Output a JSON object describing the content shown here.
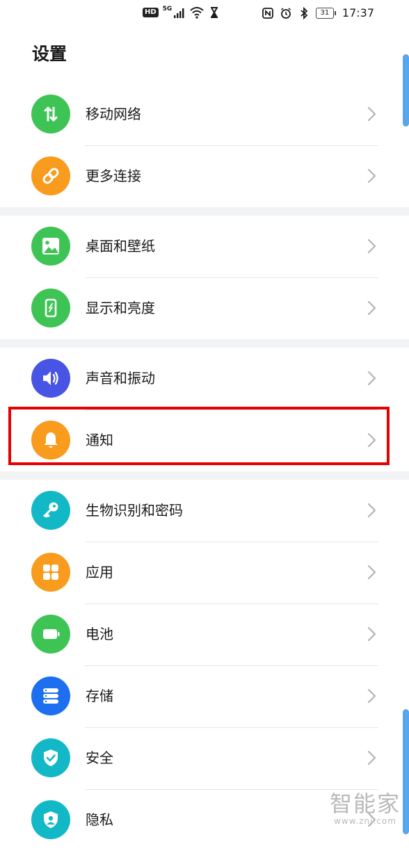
{
  "status_bar": {
    "hd": "HD",
    "network": "5G",
    "battery": "31",
    "time": "17:37",
    "icons": [
      "signal-icon",
      "wifi-icon",
      "hourglass-icon",
      "nfc-icon",
      "alarm-icon",
      "bluetooth-icon"
    ]
  },
  "title": "设置",
  "groups": [
    {
      "items": [
        {
          "label": "移动网络",
          "icon": "mobile-data-icon",
          "color": "#3ec455"
        },
        {
          "label": "更多连接",
          "icon": "link-icon",
          "color": "#f99b1c"
        }
      ]
    },
    {
      "items": [
        {
          "label": "桌面和壁纸",
          "icon": "image-icon",
          "color": "#3ec455"
        },
        {
          "label": "显示和亮度",
          "icon": "phone-brightness-icon",
          "color": "#3ec455"
        }
      ]
    },
    {
      "items": [
        {
          "label": "声音和振动",
          "icon": "speaker-icon",
          "color": "#4754e4"
        },
        {
          "label": "通知",
          "icon": "bell-icon",
          "color": "#f99b1c"
        }
      ]
    },
    {
      "items": [
        {
          "label": "生物识别和密码",
          "icon": "key-icon",
          "color": "#13b8c6"
        },
        {
          "label": "应用",
          "icon": "apps-grid-icon",
          "color": "#f99b1c"
        },
        {
          "label": "电池",
          "icon": "battery-icon",
          "color": "#3ec455"
        },
        {
          "label": "存储",
          "icon": "storage-icon",
          "color": "#1e6ff0"
        },
        {
          "label": "安全",
          "icon": "shield-icon",
          "color": "#13b8c6"
        },
        {
          "label": "隐私",
          "icon": "privacy-icon",
          "color": "#13b8c6"
        }
      ]
    }
  ],
  "watermark": {
    "main": "智能家",
    "sub": "www.znj.com"
  }
}
